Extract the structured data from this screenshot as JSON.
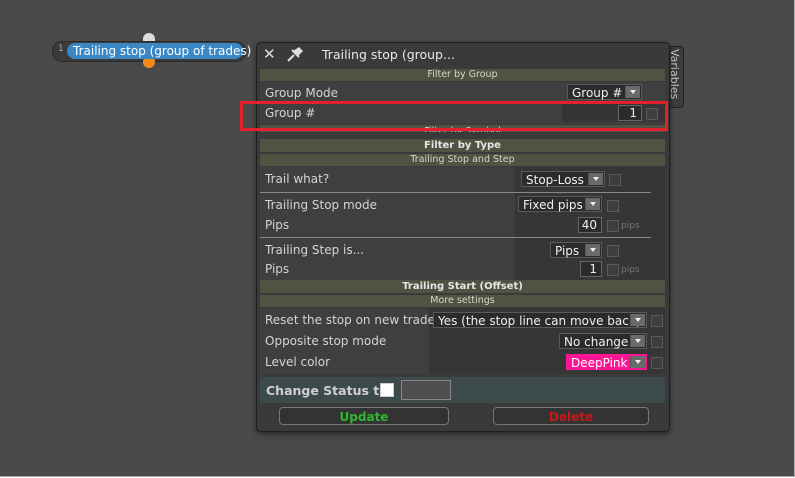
{
  "node": {
    "number": "1",
    "label": "Trailing stop (group of trades)"
  },
  "panel": {
    "title": "Trailing stop (group...",
    "variables_tab": "Variables",
    "filter_by_group": "Filter by Group",
    "group_mode_label": "Group Mode",
    "group_mode_value": "Group #",
    "group_num_label": "Group #",
    "group_num_value": "1",
    "filter_by_symbol": "Filter by Symbol",
    "filter_by_type": "Filter by Type",
    "trailing_stop_and_step": "Trailing Stop and Step",
    "trail_what_label": "Trail what?",
    "trail_what_value": "Stop-Loss",
    "ts_mode_label": "Trailing Stop mode",
    "ts_mode_value": "Fixed pips",
    "pips_label": "Pips",
    "ts_pips_value": "40",
    "pips_unit": "pips",
    "step_is_label": "Trailing Step is...",
    "step_is_value": "Pips",
    "step_pips_value": "1",
    "trailing_start": "Trailing Start (Offset)",
    "more_settings": "More settings",
    "reset_label": "Reset the stop on new trade",
    "reset_value": "Yes (the stop line can move back)",
    "opp_label": "Opposite stop mode",
    "opp_value": "No change",
    "level_color_label": "Level color",
    "level_color_value": "DeepPink",
    "change_status_label": "Change Status to",
    "update_label": "Update",
    "delete_label": "Delete"
  },
  "colors": {
    "node": "#3a87c6",
    "deeppink": "#ff1493",
    "update": "#2db82d",
    "delete": "#c81818",
    "highlight": "#e4202c"
  }
}
